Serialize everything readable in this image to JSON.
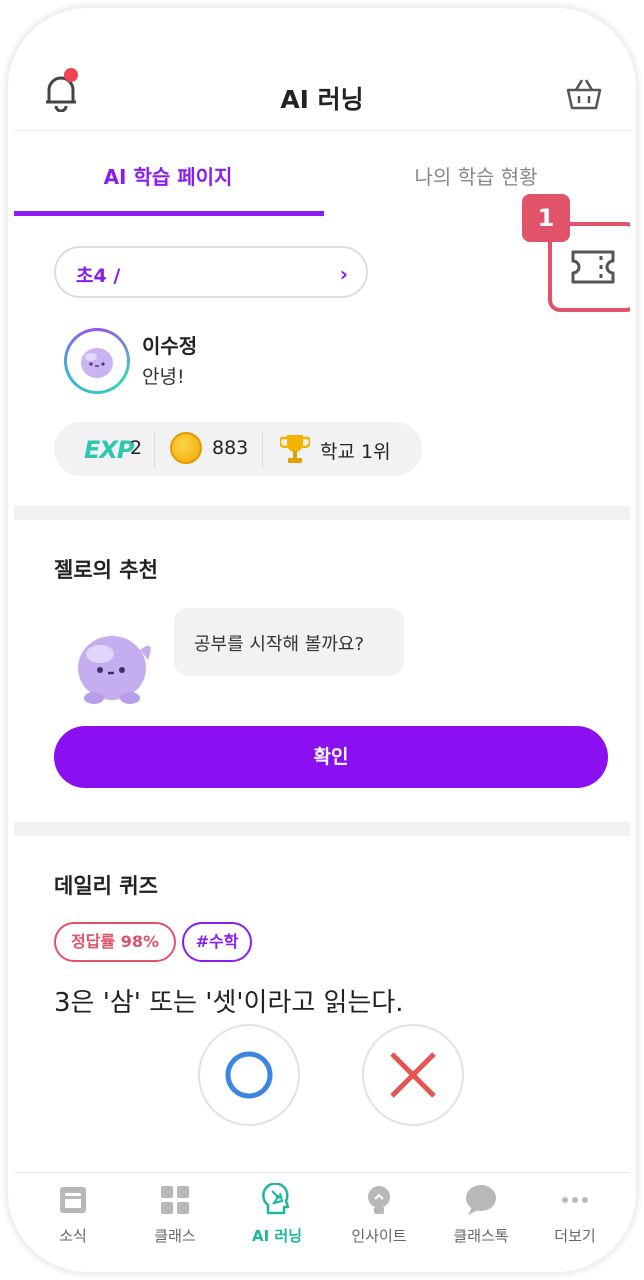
{
  "header": {
    "title": "AI 러닝",
    "left_icon": "bell-icon",
    "right_icon": "basket-icon",
    "notification_dot_color": "#f04452"
  },
  "tabs": [
    {
      "label": "AI 학습 페이지",
      "active": true
    },
    {
      "label": "나의 학습 현황",
      "active": false
    }
  ],
  "profile": {
    "grade_selector": "초4 /",
    "name": "이수정",
    "greeting": "안녕!",
    "stats": {
      "exp_label": "EXP",
      "exp_value": "2",
      "coin_value": "883",
      "rank": "학교 1위"
    }
  },
  "highlight": {
    "badge": "1",
    "icon": "ticket-icon",
    "color": "#e05369"
  },
  "recommendation": {
    "title": "젤로의 추천",
    "message": "공부를 시작해 볼까요?",
    "button": "확인"
  },
  "quiz": {
    "title": "데일리 퀴즈",
    "accuracy_tag": "정답률 98%",
    "subject_tag": "#수학",
    "question": "3은 '삼' 또는 '셋'이라고 읽는다.",
    "answer_o_icon": "circle-o-icon",
    "answer_x_icon": "cross-x-icon"
  },
  "bottom_nav": [
    {
      "label": "소식",
      "icon": "news-icon",
      "active": false
    },
    {
      "label": "클래스",
      "icon": "grid-icon",
      "active": false
    },
    {
      "label": "AI 러닝",
      "icon": "ai-brain-icon",
      "active": true
    },
    {
      "label": "인사이트",
      "icon": "lightbulb-icon",
      "active": false
    },
    {
      "label": "클래스톡",
      "icon": "chat-icon",
      "active": false
    },
    {
      "label": "더보기",
      "icon": "more-icon",
      "active": false
    }
  ],
  "colors": {
    "accent": "#8a1cf0",
    "button": "#8a10f2",
    "highlight": "#e05369",
    "active_nav": "#1fb5a0"
  }
}
